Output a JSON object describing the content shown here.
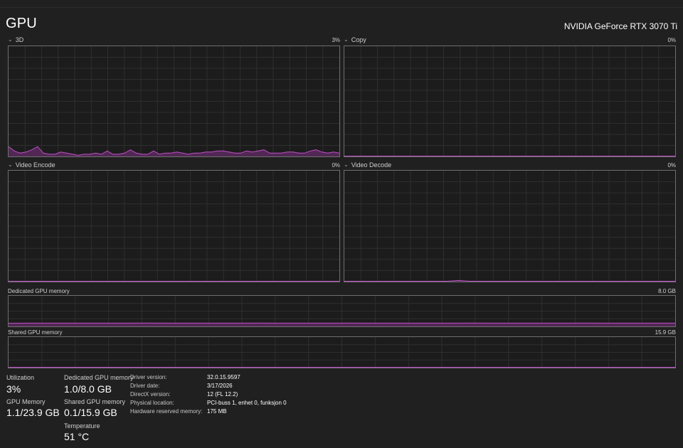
{
  "header": {
    "title": "GPU",
    "model": "NVIDIA GeForce RTX 3070 Ti"
  },
  "colors": {
    "accent": "#c04fc9",
    "fill": "#5a2a5e",
    "grid": "#2e2e2e",
    "border": "#6e6e6e"
  },
  "engines": {
    "threed": {
      "label": "3D",
      "percent": "3%"
    },
    "copy": {
      "label": "Copy",
      "percent": "0%"
    },
    "video_encode": {
      "label": "Video Encode",
      "percent": "0%"
    },
    "video_decode": {
      "label": "Video Decode",
      "percent": "0%"
    }
  },
  "memory_graphs": {
    "dedicated": {
      "label": "Dedicated GPU memory",
      "max": "8.0 GB"
    },
    "shared": {
      "label": "Shared GPU memory",
      "max": "15.9 GB"
    }
  },
  "stats": {
    "utilization": {
      "label": "Utilization",
      "value": "3%"
    },
    "gpu_memory": {
      "label": "GPU Memory",
      "value": "1.1/23.9 GB"
    },
    "dedicated": {
      "label": "Dedicated GPU memory",
      "value": "1.0/8.0 GB"
    },
    "shared": {
      "label": "Shared GPU memory",
      "value": "0.1/15.9 GB"
    },
    "temperature": {
      "label": "Temperature",
      "value": "51 °C"
    }
  },
  "driver": {
    "version": {
      "label": "Driver version:",
      "value": "32.0.15.9597"
    },
    "date": {
      "label": "Driver date:",
      "value": "3/17/2026"
    },
    "directx": {
      "label": "DirectX version:",
      "value": "12 (FL 12.2)"
    },
    "location": {
      "label": "Physical location:",
      "value": "PCI-buss 1, enhet 0, funksjon 0"
    },
    "reserved": {
      "label": "Hardware reserved memory:",
      "value": "175 MB"
    }
  },
  "chart_data": [
    {
      "type": "area",
      "name": "3D",
      "ylim": [
        0,
        100
      ],
      "values": [
        9,
        5,
        3,
        4,
        6,
        9,
        3,
        2,
        2,
        4,
        3,
        2,
        1,
        2,
        2,
        3,
        2,
        5,
        2,
        2,
        3,
        6,
        3,
        2,
        2,
        5,
        2,
        3,
        3,
        4,
        3,
        2,
        3,
        3,
        4,
        4,
        5,
        5,
        4,
        3,
        3,
        5,
        4,
        5,
        6,
        3,
        3,
        3,
        4,
        4,
        3,
        3,
        5,
        6,
        4,
        3,
        4,
        3
      ]
    },
    {
      "type": "area",
      "name": "Copy",
      "ylim": [
        0,
        100
      ],
      "values": [
        0,
        0,
        0,
        0,
        0,
        0,
        0,
        0,
        0,
        0,
        0,
        0
      ]
    },
    {
      "type": "area",
      "name": "Video Encode",
      "ylim": [
        0,
        100
      ],
      "values": [
        0,
        0,
        0,
        0,
        0,
        0,
        0,
        0,
        0,
        0,
        0,
        0
      ]
    },
    {
      "type": "area",
      "name": "Video Decode",
      "ylim": [
        0,
        100
      ],
      "values": [
        0,
        0,
        0,
        0,
        0,
        0,
        0,
        0,
        0,
        0,
        1,
        0,
        0,
        0,
        0,
        0,
        0,
        0,
        0,
        0,
        0,
        0,
        0,
        0,
        0,
        0,
        0,
        0,
        0,
        0
      ]
    },
    {
      "type": "area",
      "name": "Dedicated GPU memory",
      "ylim": [
        0,
        8
      ],
      "values": [
        0.84,
        0.86,
        0.85,
        0.86,
        0.85,
        0.86,
        0.88,
        0.85,
        0.86,
        0.85,
        0.86,
        0.87,
        0.86,
        0.85,
        0.86,
        0.87,
        0.86,
        0.86,
        0.85,
        0.86,
        0.87,
        0.86,
        0.85,
        0.86,
        0.86,
        0.87,
        0.86,
        0.85,
        0.86,
        0.86
      ]
    },
    {
      "type": "area",
      "name": "Shared GPU memory",
      "ylim": [
        0,
        15.9
      ],
      "values": [
        0,
        0,
        0,
        0,
        0,
        0,
        0,
        0,
        0,
        0,
        0,
        0
      ]
    }
  ]
}
